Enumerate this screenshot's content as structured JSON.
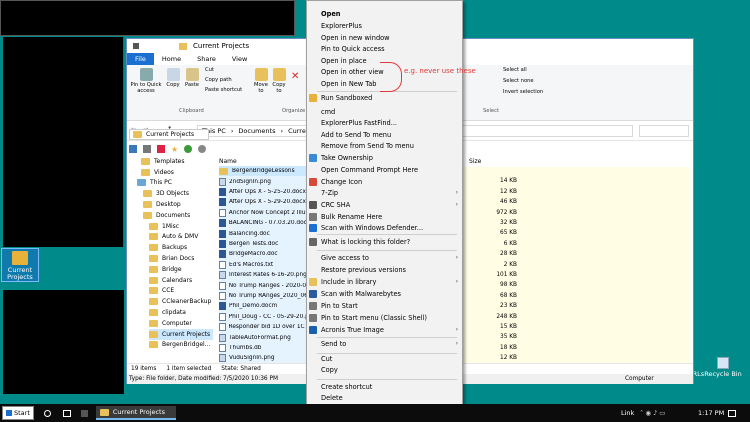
{
  "desktop": {
    "icons": [
      {
        "label": "Current Projects"
      },
      {
        "label": "URLs"
      },
      {
        "label": "Recycle Bin"
      }
    ]
  },
  "explorer": {
    "title": "Current Projects",
    "ribbon_tabs": [
      "File",
      "Home",
      "Share",
      "View"
    ],
    "clipboard": {
      "pin": "Pin to Quick access",
      "copy": "Copy",
      "paste": "Paste",
      "cut": "Cut",
      "copy_path": "Copy path",
      "paste_shortcut": "Paste shortcut",
      "group": "Clipboard"
    },
    "organize": {
      "move": "Move to",
      "copy": "Copy to",
      "group": "Organize"
    },
    "select": {
      "all": "Select all",
      "none": "Select none",
      "invert": "Invert selection",
      "group": "Select"
    },
    "address": {
      "this_pc": "This PC",
      "documents": "Documents",
      "current": "Current Projects"
    },
    "tab_current": "Current Projects",
    "tree": [
      "Templates",
      "Videos",
      "This PC",
      "3D Objects",
      "Desktop",
      "Documents",
      "1Misc",
      "Auto & DMV",
      "Backups",
      "Brian Docs",
      "Bridge",
      "Calendars",
      "CCE",
      "CCleanerBackup",
      "clipdata",
      "Computer",
      "Current Projects",
      "BergenBridgel..."
    ],
    "columns": {
      "name": "Name",
      "size": "Size"
    },
    "files": [
      {
        "name": "BergenBridgeLessons",
        "size": ""
      },
      {
        "name": "2ndSignIn.png",
        "size": "14 KB"
      },
      {
        "name": "After Ops X - 5-25-20.docx",
        "size": "12 KB"
      },
      {
        "name": "After Ops X - 5-29-20.docx",
        "size": "46 KB"
      },
      {
        "name": "Anchor Now Concept 2 Illust",
        "size": "972 KB"
      },
      {
        "name": "BALANCING - 07.03.20.docx",
        "size": "32 KB"
      },
      {
        "name": "Balancing.doc",
        "size": "65 KB"
      },
      {
        "name": "Bergen Tests.doc",
        "size": "6 KB"
      },
      {
        "name": "BridgeMacro.doc",
        "size": "28 KB"
      },
      {
        "name": "Ed's Macros.txt",
        "size": "2 KB"
      },
      {
        "name": "Interest Rates 6-16-20.png",
        "size": "101 KB"
      },
      {
        "name": "No Trump Ranges - 2020-06-",
        "size": "98 KB"
      },
      {
        "name": "No Trump RAnges_2020_06_2",
        "size": "68 KB"
      },
      {
        "name": "Phil_Demo.docm",
        "size": "23 KB"
      },
      {
        "name": "Phil_Doug - CC - 05-29-20.pn",
        "size": "248 KB"
      },
      {
        "name": "Responder bid 1D over 1C - D",
        "size": "15 KB"
      },
      {
        "name": "TableAutoFormat.png",
        "size": "35 KB"
      },
      {
        "name": "Thumbs.db",
        "size": "18 KB"
      },
      {
        "name": "VuduSignIn.png",
        "size": "12 KB"
      }
    ],
    "status": {
      "items": "19 items",
      "selected": "1 item selected",
      "shared": "State: Shared",
      "details": "Type: File folder, Date modified: 7/5/2020 10:36 PM",
      "computer": "Computer"
    }
  },
  "menu": {
    "items": [
      "Open",
      "ExplorerPlus",
      "Open in new window",
      "Pin to Quick access",
      "Open in place",
      "Open in other view",
      "Open in New Tab",
      "Run Sandboxed",
      "cmd",
      "ExplorerPlus FastFind...",
      "Add to Send To menu",
      "Remove from Send To menu",
      "Take Ownership",
      "Open Command Prompt Here",
      "Change Icon",
      "7-Zip",
      "CRC SHA",
      "Bulk Rename Here",
      "Scan with Windows Defender...",
      "What is locking this folder?",
      "Give access to",
      "Restore previous versions",
      "Include in library",
      "Scan with Malwarebytes",
      "Pin to Start",
      "Pin to Start menu (Classic Shell)",
      "Acronis True Image",
      "Send to",
      "Cut",
      "Copy",
      "Create shortcut",
      "Delete"
    ],
    "annotation": "e.g. never use these"
  },
  "taskbar": {
    "start": "Start",
    "app": "Current Projects",
    "link": "Link",
    "time": "1:17 PM"
  },
  "colors": {
    "desktop": "#008a8a",
    "accent": "#1a6fd1",
    "annotation": "#e03a3a"
  }
}
